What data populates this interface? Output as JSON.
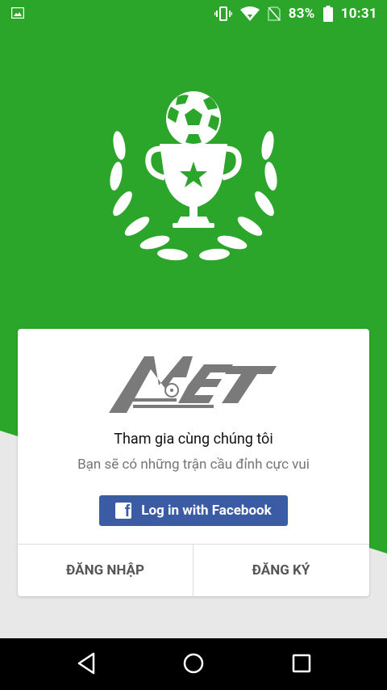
{
  "status_bar": {
    "battery_percent": "83%",
    "time": "10:31",
    "icons": [
      "gallery-icon",
      "vibrate-icon",
      "wifi-icon",
      "no-sim-icon",
      "battery-icon"
    ]
  },
  "colors": {
    "brand_green": "#2ba52a",
    "facebook_blue": "#3b5ca4"
  },
  "hero": {
    "icon": "trophy-laurel-icon"
  },
  "card": {
    "logo": "MET",
    "title": "Tham gia cùng chúng tôi",
    "subtitle": "Bạn sẽ có những trận cầu đỉnh cực vui",
    "facebook_button": "Log in with Facebook",
    "login_button": "ĐĂNG NHẬP",
    "register_button": "ĐĂNG KÝ"
  },
  "nav_bar": {
    "buttons": [
      "back-icon",
      "home-icon",
      "recents-icon"
    ]
  }
}
